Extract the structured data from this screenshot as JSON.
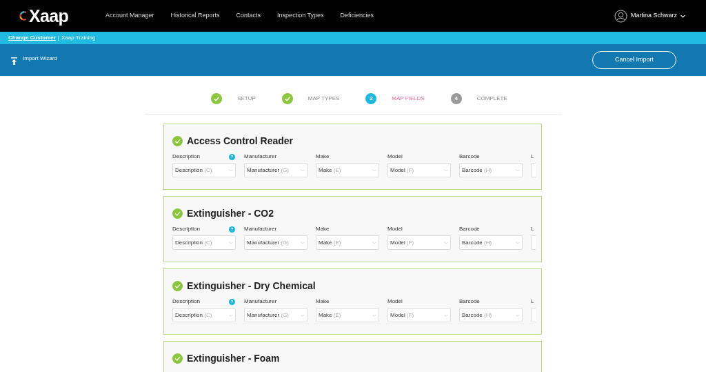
{
  "brand": {
    "logo": "Xaap"
  },
  "nav": [
    {
      "label": "Account Manager"
    },
    {
      "label": "Historical Reports"
    },
    {
      "label": "Contacts"
    },
    {
      "label": "Inspection Types"
    },
    {
      "label": "Deficiencies"
    }
  ],
  "user": {
    "name": "Martina Schwarz"
  },
  "customer_bar": {
    "link": "Change Customer",
    "separator": "|",
    "customer": "Xaap Training"
  },
  "toolbar": {
    "title": "Import Wizard",
    "button": "Cancel Import"
  },
  "steps": [
    {
      "label": "SETUP",
      "done": true,
      "selected": false
    },
    {
      "label": "MAP TYPES",
      "done": true,
      "selected": false
    },
    {
      "label": "MAP FIELDS",
      "done": false,
      "selected": true,
      "number": "3"
    },
    {
      "label": "COMPLETE",
      "done": false,
      "selected": false,
      "number": "4"
    }
  ],
  "types": [
    {
      "name": "Access Control Reader",
      "complete": true,
      "fields": [
        {
          "label": "Description",
          "help": "?",
          "value": "Description",
          "source": "(C)"
        },
        {
          "label": "Manufacturer",
          "value": "Manufacturer",
          "source": "(G)"
        },
        {
          "label": "Make",
          "value": "Make",
          "source": "(E)"
        },
        {
          "label": "Model",
          "value": "Model",
          "source": "(F)"
        },
        {
          "label": "Barcode",
          "value": "Barcode",
          "source": "(H)"
        },
        {
          "label": "L"
        }
      ]
    },
    {
      "name": "Extinguisher - CO2",
      "complete": true,
      "fields": [
        {
          "label": "Description",
          "help": "?",
          "value": "Description",
          "source": "(C)"
        },
        {
          "label": "Manufacturer",
          "value": "Manufacturer",
          "source": "(G)"
        },
        {
          "label": "Make",
          "value": "Make",
          "source": "(E)"
        },
        {
          "label": "Model",
          "value": "Model",
          "source": "(F)"
        },
        {
          "label": "Barcode",
          "value": "Barcode",
          "source": "(H)"
        },
        {
          "label": "L"
        }
      ]
    },
    {
      "name": "Extinguisher - Dry Chemical",
      "complete": true,
      "fields": [
        {
          "label": "Description",
          "help": "?",
          "value": "Description",
          "source": "(C)"
        },
        {
          "label": "Manufacturer",
          "value": "Manufacturer",
          "source": "(G)"
        },
        {
          "label": "Make",
          "value": "Make",
          "source": "(E)"
        },
        {
          "label": "Model",
          "value": "Model",
          "source": "(F)"
        },
        {
          "label": "Barcode",
          "value": "Barcode",
          "source": "(H)"
        },
        {
          "label": "L"
        }
      ]
    },
    {
      "name": "Extinguisher - Foam",
      "complete": true
    }
  ]
}
